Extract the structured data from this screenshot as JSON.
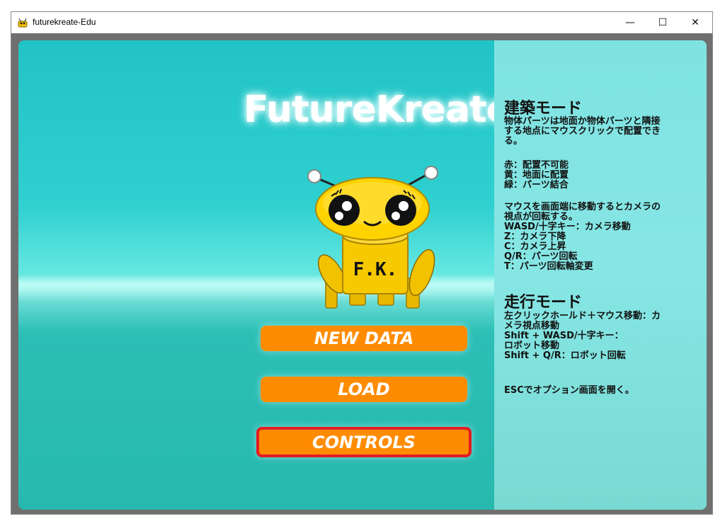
{
  "window": {
    "title": "futurekreate-Edu",
    "controls": {
      "minimize": "—",
      "maximize": "☐",
      "close": "✕"
    }
  },
  "game": {
    "logo": "FutureKreate",
    "mascot_label": "F.K.",
    "menu": {
      "new_data": "NEW DATA",
      "load": "LOAD",
      "controls": "CONTROLS"
    },
    "help": {
      "build_mode_title": "建築モード",
      "build_mode_desc": "物体パーツは地面か物体パーツと隣接\nする地点にマウスクリックで配置でき\nる。",
      "color_legend": "赤：配置不可能\n黄：地面に配置\n緑：パーツ結合",
      "camera_controls": "マウスを画面端に移動するとカメラの\n視点が回転する。\nWASD/十字キー：カメラ移動\nZ：カメラ下降\nC：カメラ上昇\nQ/R：パーツ回転\nT：パーツ回転軸変更",
      "drive_mode_title": "走行モード",
      "drive_mode_desc": "左クリックホールド＋マウス移動：カ\nメラ視点移動\nShift + WASD/十字キー：\nロボット移動\nShift + Q/R：ロボット回転",
      "esc_hint": "ESCでオプション画面を開く。"
    }
  }
}
